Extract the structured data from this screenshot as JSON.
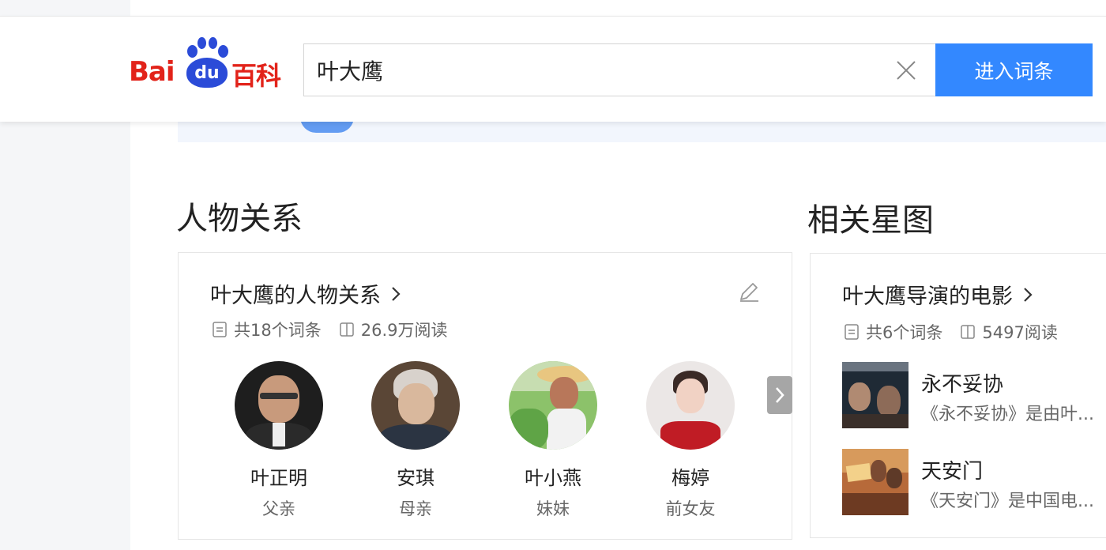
{
  "header": {
    "logo_left": "Bai",
    "logo_paw": "du",
    "logo_right": "百科",
    "search_value": "叶大鹰",
    "search_button": "进入词条"
  },
  "relations": {
    "section_title": "人物关系",
    "card_title": "叶大鹰的人物关系",
    "entry_count": "共18个词条",
    "read_count": "26.9万阅读",
    "people": [
      {
        "name": "叶正明",
        "relation": "父亲"
      },
      {
        "name": "安琪",
        "relation": "母亲"
      },
      {
        "name": "叶小燕",
        "relation": "妹妹"
      },
      {
        "name": "梅婷",
        "relation": "前女友"
      }
    ]
  },
  "star_map": {
    "section_title": "相关星图",
    "card_title": "叶大鹰导演的电影",
    "entry_count": "共6个词条",
    "read_count": "5497阅读",
    "movies": [
      {
        "title": "永不妥协",
        "desc": "《永不妥协》是由叶..."
      },
      {
        "title": "天安门",
        "desc": "《天安门》是中国电..."
      }
    ]
  },
  "colors": {
    "brand_red": "#e2231a",
    "brand_blue": "#2b4bd8",
    "button_blue": "#3388ff"
  },
  "icons": [
    "close-icon",
    "chevron-right-icon",
    "document-icon",
    "book-icon",
    "edit-pencil-icon"
  ]
}
